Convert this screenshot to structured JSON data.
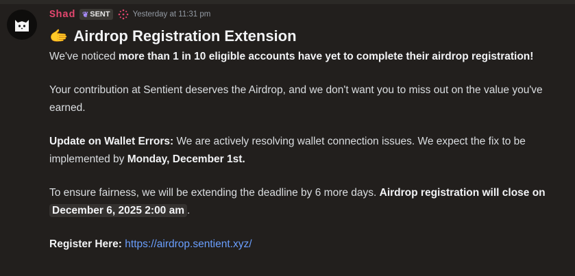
{
  "message": {
    "author": "Shad",
    "tag": "SENT",
    "timestamp": "Yesterday at 11:31 pm",
    "heading_emoji": "🫱",
    "heading": "Airdrop Registration Extension",
    "p1_lead": "We've noticed ",
    "p1_bold": "more than 1 in 10 eligible accounts have yet to complete their airdrop registration!",
    "p2": "Your contribution at Sentient deserves the Airdrop, and we don't want you to miss out on the value you've earned.",
    "p3_bold": "Update on Wallet Errors:",
    "p3_text": " We are actively resolving wallet connection issues. We expect the fix to be implemented by ",
    "p3_date": "Monday, December 1st.",
    "p4_text": "To ensure fairness, we will be extending the deadline by 6 more days. ",
    "p4_bold": "Airdrop registration will close on",
    "p4_date": "December 6, 2025 2:00 am",
    "p4_end": ".",
    "p5_bold": "Register Here:",
    "p5_link": "https://airdrop.sentient.xyz/"
  },
  "colors": {
    "username": "#e0466d",
    "link": "#6a9fff",
    "background": "#221f1d"
  },
  "icons": {
    "avatar": "cat-avatar-icon",
    "tag": "leaf-icon",
    "role": "sparkle-role-icon"
  }
}
